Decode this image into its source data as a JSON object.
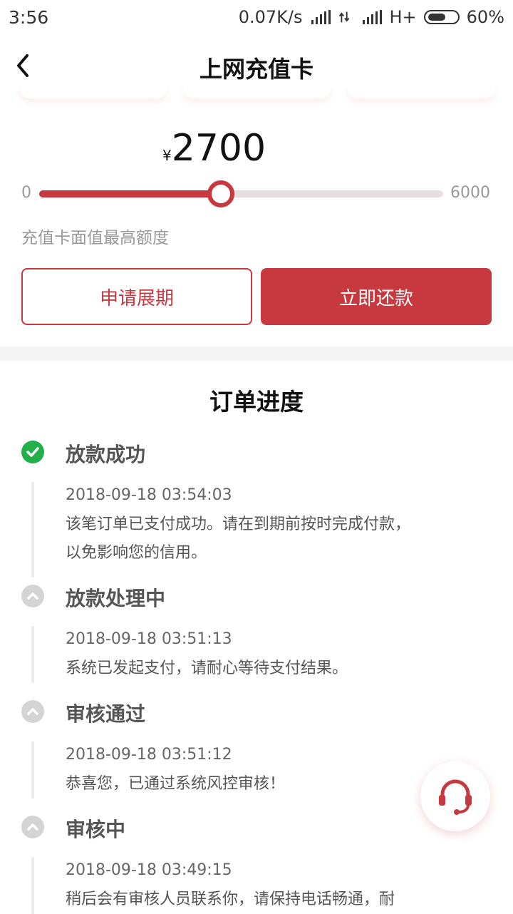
{
  "status": {
    "time": "3:56",
    "network_speed": "0.07K/s",
    "network_type": "H+",
    "battery_percent": "60%",
    "battery_level": 0.6
  },
  "header": {
    "title": "上网充值卡",
    "back_icon": "chevron-left-icon"
  },
  "amount": {
    "currency_symbol": "¥",
    "value": "2700"
  },
  "slider": {
    "min_label": "0",
    "max_label": "6000",
    "min": 0,
    "max": 6000,
    "value": 2700,
    "caption": "充值卡面值最高额度"
  },
  "actions": {
    "extend_label": "申请展期",
    "repay_label": "立即还款"
  },
  "progress": {
    "title": "订单进度",
    "steps": [
      {
        "status": "done",
        "title": "放款成功",
        "time": "2018-09-18 03:54:03",
        "desc": "该笔订单已支付成功。请在到期前按时完成付款，以免影响您的信用。"
      },
      {
        "status": "pending",
        "title": "放款处理中",
        "time": "2018-09-18 03:51:13",
        "desc": "系统已发起支付，请耐心等待支付结果。"
      },
      {
        "status": "pending",
        "title": "审核通过",
        "time": "2018-09-18 03:51:12",
        "desc": "恭喜您，已通过系统风控审核！"
      },
      {
        "status": "pending",
        "title": "审核中",
        "time": "2018-09-18 03:49:15",
        "desc": "稍后会有审核人员联系你，请保持电话畅通，耐"
      }
    ]
  },
  "colors": {
    "brand_red": "#c8383f",
    "success_green": "#22b04a",
    "pending_gray": "#d4d4d4"
  },
  "floating": {
    "service_icon": "headset-icon"
  }
}
